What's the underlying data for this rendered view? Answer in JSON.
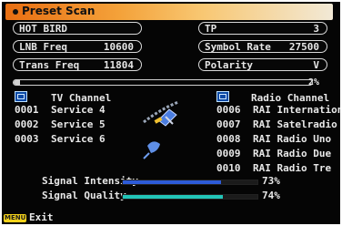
{
  "header": {
    "title": "Preset Scan"
  },
  "fields": {
    "satellite": {
      "value": "HOT BIRD"
    },
    "tp": {
      "label": "TP",
      "value": "3"
    },
    "lnb_freq": {
      "label": "LNB Freq",
      "value": "10600"
    },
    "symbol_rate": {
      "label": "Symbol Rate",
      "value": "27500"
    },
    "trans_freq": {
      "label": "Trans Freq",
      "value": "11804"
    },
    "polarity": {
      "label": "Polarity",
      "value": "V"
    }
  },
  "scan_progress": {
    "percent": 2,
    "label": "2%"
  },
  "tv": {
    "heading": "TV Channel",
    "items": [
      {
        "num": "0001",
        "name": "Service 4"
      },
      {
        "num": "0002",
        "name": "Service 5"
      },
      {
        "num": "0003",
        "name": "Service 6"
      }
    ]
  },
  "radio": {
    "heading": "Radio Channel",
    "items": [
      {
        "num": "0006",
        "name": "RAI Internation"
      },
      {
        "num": "0007",
        "name": "RAI Satelradio"
      },
      {
        "num": "0008",
        "name": "RAI Radio Uno"
      },
      {
        "num": "0009",
        "name": "RAI Radio Due"
      },
      {
        "num": "0010",
        "name": "RAI Radio Tre"
      }
    ]
  },
  "signal": {
    "intensity": {
      "label": "Signal Intensity",
      "percent": 73,
      "value": "73%",
      "color": "#2d5bd8"
    },
    "quality": {
      "label": "Signal Quality",
      "percent": 74,
      "value": "74%",
      "color": "#22c5b8"
    }
  },
  "footer": {
    "menu_key": "MENU",
    "exit": "Exit"
  },
  "icons": {
    "tv": "tv-channel-icon",
    "radio": "radio-channel-icon",
    "satellite": "satellite-icon"
  }
}
